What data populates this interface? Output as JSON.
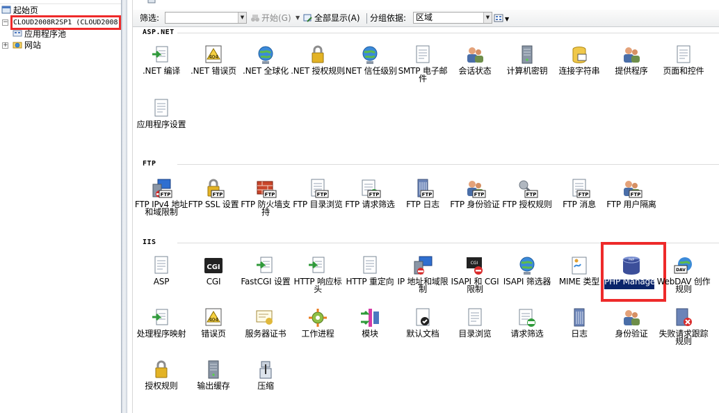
{
  "tree": {
    "start_page": "起始页",
    "server": "CLOUD2008R2SP1 (CLOUD2008",
    "app_pools": "应用程序池",
    "sites": "网站"
  },
  "filterbar": {
    "filter_label": "筛选:",
    "start_label": "开始(G)",
    "show_all_label": "全部显示(A)",
    "group_by_label": "分组依据:",
    "group_by_value": "区域"
  },
  "sections": [
    {
      "title": "ASP.NET",
      "items": [
        {
          "label": ".NET 编译",
          "icon": "net-compile-icon"
        },
        {
          "label": ".NET 错误页",
          "icon": "net-error-page-icon"
        },
        {
          "label": ".NET 全球化",
          "icon": "net-globalization-icon"
        },
        {
          "label": ".NET 授权规则",
          "icon": "net-authorization-icon"
        },
        {
          "label": ".NET 信任级别",
          "icon": "net-trust-icon"
        },
        {
          "label": "SMTP 电子邮件",
          "icon": "smtp-email-icon"
        },
        {
          "label": "会话状态",
          "icon": "session-state-icon"
        },
        {
          "label": "计算机密钥",
          "icon": "machine-key-icon"
        },
        {
          "label": "连接字符串",
          "icon": "connection-string-icon"
        },
        {
          "label": "提供程序",
          "icon": "providers-icon"
        },
        {
          "label": "页面和控件",
          "icon": "pages-controls-icon"
        },
        {
          "label": "应用程序设置",
          "icon": "app-settings-icon"
        }
      ]
    },
    {
      "title": "FTP",
      "items": [
        {
          "label": "FTP IPv4 地址和域限制",
          "icon": "ftp-ipv4-icon"
        },
        {
          "label": "FTP SSL 设置",
          "icon": "ftp-ssl-icon"
        },
        {
          "label": "FTP 防火墙支持",
          "icon": "ftp-firewall-icon"
        },
        {
          "label": "FTP 目录浏览",
          "icon": "ftp-dir-browse-icon"
        },
        {
          "label": "FTP 请求筛选",
          "icon": "ftp-request-filter-icon"
        },
        {
          "label": "FTP 日志",
          "icon": "ftp-log-icon"
        },
        {
          "label": "FTP 身份验证",
          "icon": "ftp-auth-icon"
        },
        {
          "label": "FTP 授权规则",
          "icon": "ftp-authz-icon"
        },
        {
          "label": "FTP 消息",
          "icon": "ftp-message-icon"
        },
        {
          "label": "FTP 用户隔离",
          "icon": "ftp-user-isolation-icon"
        }
      ]
    },
    {
      "title": "IIS",
      "items": [
        {
          "label": "ASP",
          "icon": "asp-icon"
        },
        {
          "label": "CGI",
          "icon": "cgi-icon"
        },
        {
          "label": "FastCGI 设置",
          "icon": "fastcgi-icon"
        },
        {
          "label": "HTTP 响应标头",
          "icon": "http-headers-icon"
        },
        {
          "label": "HTTP 重定向",
          "icon": "http-redirect-icon"
        },
        {
          "label": "IP 地址和域限制",
          "icon": "ip-restrict-icon"
        },
        {
          "label": "ISAPI 和 CGI 限制",
          "icon": "isapi-cgi-icon"
        },
        {
          "label": "ISAPI 筛选器",
          "icon": "isapi-filter-icon"
        },
        {
          "label": "MIME 类型",
          "icon": "mime-type-icon"
        },
        {
          "label": "PHP Manager",
          "icon": "php-manager-icon"
        },
        {
          "label": "WebDAV 创作规则",
          "icon": "webdav-icon"
        },
        {
          "label": "处理程序映射",
          "icon": "handler-map-icon"
        },
        {
          "label": "错误页",
          "icon": "error-page-icon"
        },
        {
          "label": "服务器证书",
          "icon": "server-cert-icon"
        },
        {
          "label": "工作进程",
          "icon": "worker-process-icon"
        },
        {
          "label": "模块",
          "icon": "modules-icon"
        },
        {
          "label": "默认文档",
          "icon": "default-doc-icon"
        },
        {
          "label": "目录浏览",
          "icon": "dir-browse-icon"
        },
        {
          "label": "请求筛选",
          "icon": "request-filter-icon"
        },
        {
          "label": "日志",
          "icon": "log-icon"
        },
        {
          "label": "身份验证",
          "icon": "auth-icon"
        },
        {
          "label": "失败请求跟踪规则",
          "icon": "failed-request-icon"
        },
        {
          "label": "授权规则",
          "icon": "authz-icon"
        },
        {
          "label": "输出缓存",
          "icon": "output-cache-icon"
        },
        {
          "label": "压缩",
          "icon": "compression-icon"
        }
      ]
    }
  ],
  "colors": {
    "highlight_red": "#ee2a2a",
    "selection_blue": "#0a246a"
  }
}
